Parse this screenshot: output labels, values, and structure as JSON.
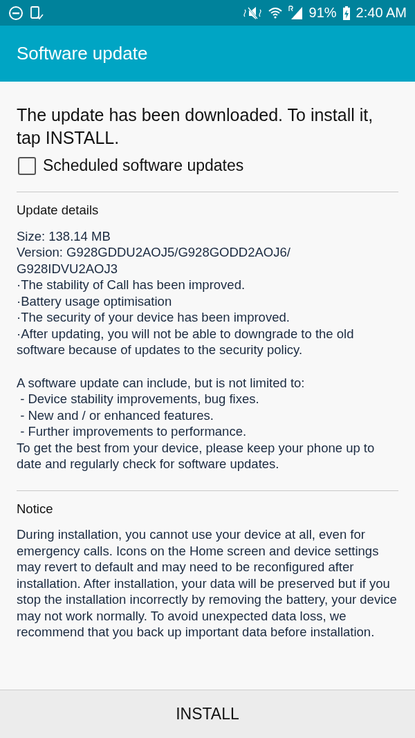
{
  "status_bar": {
    "battery": "91%",
    "time": "2:40 AM"
  },
  "app_bar": {
    "title": "Software update"
  },
  "message": "The update has been downloaded. To install it, tap INSTALL.",
  "scheduled_updates": {
    "label": "Scheduled software updates",
    "checked": false
  },
  "update_details": {
    "heading": "Update details",
    "size": "Size: 138.14 MB",
    "version": "Version: G928GDDU2AOJ5/G928GODD2AOJ6/ G928IDVU2AOJ3",
    "changes": [
      "·The stability of Call has been improved.",
      "·Battery usage optimisation",
      "·The security of your device has been improved.",
      "·After updating, you will not be able to downgrade to the old software because of updates to the security policy."
    ],
    "intro": "A software update can include, but is not limited to:",
    "includes": [
      " - Device stability improvements, bug fixes.",
      " - New and / or enhanced features.",
      " - Further improvements to performance."
    ],
    "advice": "To get the best from your device, please keep your phone up to date and regularly check for software updates."
  },
  "notice": {
    "heading": "Notice",
    "text": "During installation, you cannot use your device at all, even for emergency calls. Icons on the Home screen and device settings may revert to default and may need to be reconfigured after installation. After installation, your data will be preserved but if you stop the installation incorrectly by removing the battery, your device may not work normally. To avoid unexpected data loss, we recommend that you back up important data before installation."
  },
  "install_button": "INSTALL"
}
